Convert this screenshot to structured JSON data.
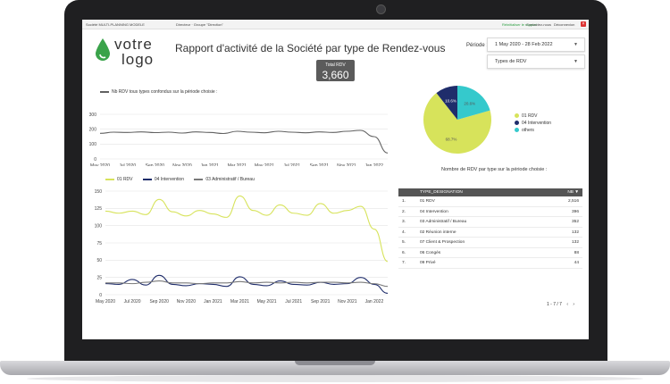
{
  "topbar": {
    "left": "Société MULTI-PLANNING MODELE",
    "mid": "Directeur · Groupe \"Direction\"",
    "r1": "Réinitialiser le rapport",
    "r2": "Contactez-nous",
    "r3": "Déconnexion"
  },
  "logo": {
    "line1": "votre",
    "line2": "logo",
    "accent": "#3aa34a"
  },
  "title": "Rapport d'activité de la Société par type de Rendez-vous",
  "kpi": {
    "label": "Total RDV",
    "value": "3,660"
  },
  "filters": {
    "period_label": "Période :",
    "period_value": "1 May 2020 - 28 Feb 2022",
    "types_value": "Types de RDV"
  },
  "icons": {
    "dropdown": "chevron-down-icon",
    "logo": "drop-icon",
    "close": "close-icon"
  },
  "chart_data": [
    {
      "type": "line",
      "legend": "Nb RDV tous types confondus sur la période choisie :",
      "x": [
        "May 2020",
        "Jun 2020",
        "Jul 2020",
        "Aug 2020",
        "Sep 2020",
        "Oct 2020",
        "Nov 2020",
        "Dec 2020",
        "Jan 2021",
        "Feb 2021",
        "Mar 2021",
        "Apr 2021",
        "May 2021",
        "Jun 2021",
        "Jul 2021",
        "Aug 2021",
        "Sep 2021",
        "Oct 2021",
        "Nov 2021",
        "Dec 2021",
        "Jan 2022",
        "Feb 2022"
      ],
      "tick_labels": [
        "May 2020",
        "Jul 2020",
        "Sep 2020",
        "Nov 2020",
        "Jan 2021",
        "Mar 2021",
        "May 2021",
        "Jul 2021",
        "Sep 2021",
        "Nov 2021",
        "Jan 2022"
      ],
      "y_ticks": [
        "300",
        "200",
        "100",
        "0"
      ],
      "ylim": [
        0,
        300
      ],
      "grid": true,
      "color": "#616161",
      "series": [
        {
          "name": "Nb RDV tous types confondus sur la période choisie :",
          "values": [
            172,
            180,
            178,
            182,
            177,
            180,
            174,
            182,
            178,
            171,
            186,
            180,
            176,
            186,
            180,
            176,
            182,
            178,
            186,
            192,
            150,
            40
          ]
        }
      ]
    },
    {
      "type": "line",
      "x": [
        "May 2020",
        "Jun 2020",
        "Jul 2020",
        "Aug 2020",
        "Sep 2020",
        "Oct 2020",
        "Nov 2020",
        "Dec 2020",
        "Jan 2021",
        "Feb 2021",
        "Mar 2021",
        "Apr 2021",
        "May 2021",
        "Jun 2021",
        "Jul 2021",
        "Aug 2021",
        "Sep 2021",
        "Oct 2021",
        "Nov 2021",
        "Dec 2021",
        "Jan 2022",
        "Feb 2022"
      ],
      "tick_labels": [
        "May 2020",
        "Jul 2020",
        "Sep 2020",
        "Nov 2020",
        "Jan 2021",
        "Mar 2021",
        "May 2021",
        "Jul 2021",
        "Sep 2021",
        "Nov 2021",
        "Jan 2022"
      ],
      "y_ticks": [
        "150",
        "125",
        "100",
        "75",
        "50",
        "25",
        "0"
      ],
      "ylim": [
        0,
        150
      ],
      "grid": true,
      "series": [
        {
          "name": "01 RDV",
          "color": "#d7e35b",
          "values": [
            121,
            118,
            121,
            116,
            138,
            120,
            114,
            122,
            117,
            112,
            143,
            122,
            115,
            130,
            118,
            115,
            132,
            118,
            122,
            128,
            95,
            48
          ]
        },
        {
          "name": "04 Intervention",
          "color": "#1f2d6b",
          "values": [
            16,
            15,
            22,
            14,
            28,
            15,
            13,
            16,
            15,
            12,
            26,
            15,
            13,
            20,
            15,
            14,
            18,
            15,
            16,
            25,
            15,
            2
          ]
        },
        {
          "name": "03 Administratif / Bureau",
          "color": "#7a7a7a",
          "values": [
            17,
            17,
            16,
            18,
            20,
            17,
            17,
            16,
            17,
            17,
            19,
            17,
            18,
            17,
            18,
            17,
            18,
            18,
            17,
            18,
            16,
            12
          ]
        }
      ]
    },
    {
      "type": "pie",
      "slices": [
        {
          "name": "01 RDV",
          "value": 68.7,
          "label": "68.7%",
          "color": "#d7e35b"
        },
        {
          "name": "04 Intervention",
          "value": 10.6,
          "label": "10.6%",
          "color": "#1f2d6b"
        },
        {
          "name": "others",
          "value": 20.6,
          "label": "20.6%",
          "color": "#35c9cc"
        }
      ],
      "legend": "right"
    },
    {
      "type": "table",
      "title": "Nombre de RDV par type sur la période choisie :",
      "columns": [
        "TYPE_DESIGNATION",
        "NB"
      ],
      "rows": [
        {
          "n": "1.",
          "d": "01 RDV",
          "v": "2,516"
        },
        {
          "n": "2.",
          "d": "04 Intervention",
          "v": "396"
        },
        {
          "n": "3.",
          "d": "03 Administratif / Bureau",
          "v": "352"
        },
        {
          "n": "4.",
          "d": "02 Réunion interne",
          "v": "132"
        },
        {
          "n": "5.",
          "d": "07 Client & Prospection",
          "v": "132"
        },
        {
          "n": "6.",
          "d": "06 Congés",
          "v": "88"
        },
        {
          "n": "7.",
          "d": "09 Privé",
          "v": "44"
        }
      ],
      "pager": "1 - 7 / 7"
    }
  ]
}
